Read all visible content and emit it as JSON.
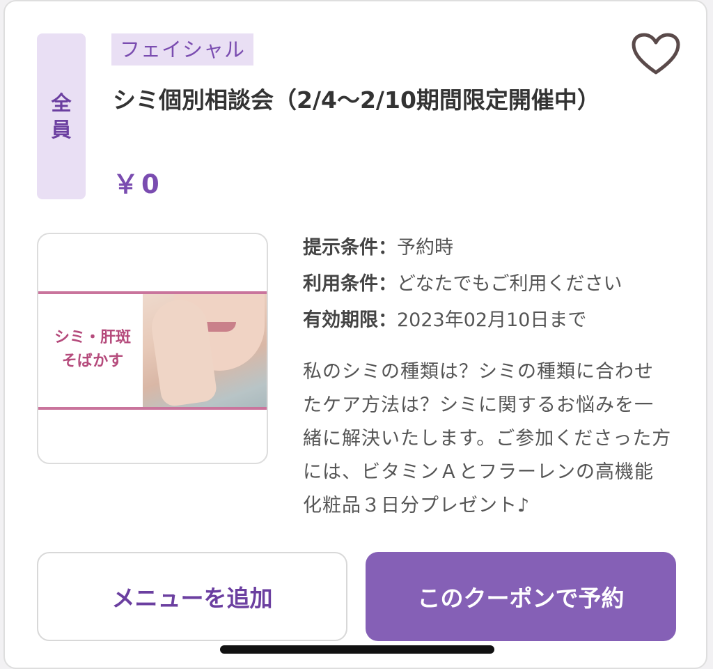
{
  "coupon": {
    "target_label_line1": "全",
    "target_label_line2": "員",
    "category": "フェイシャル",
    "title": "シミ個別相談会（2/4〜2/10期間限定開催中）",
    "price": "￥0"
  },
  "image": {
    "caption_line1": "シミ・肝斑",
    "caption_line2": "そばかす"
  },
  "conditions": {
    "presentation_label": "提示条件：",
    "presentation_value": "予約時",
    "usage_label": "利用条件：",
    "usage_value": "どなたでもご利用ください",
    "expiry_label": "有効期限：",
    "expiry_value": "2023年02月10日まで"
  },
  "description": "私のシミの種類は？シミの種類に合わせたケア方法は？シミに関するお悩みを一緒に解決いたします。ご参加くださった方には、ビタミンＡとフラーレンの高機能化粧品３日分プレゼント♪",
  "actions": {
    "add_menu_label": "メニューを追加",
    "reserve_label": "このクーポンで予約"
  },
  "icons": {
    "favorite": "heart-outline-icon"
  },
  "colors": {
    "accent": "#8560b6",
    "accent_text": "#6b3fa0",
    "tag_bg": "#e9dff4"
  }
}
